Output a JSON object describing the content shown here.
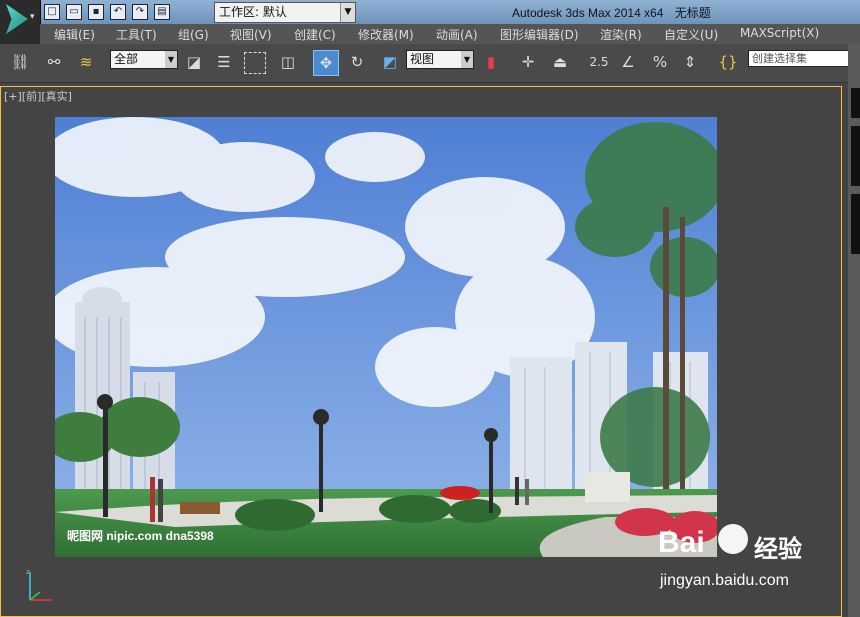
{
  "window": {
    "app_title": "Autodesk 3ds Max  2014 x64",
    "doc_title": "无标题"
  },
  "workspace": {
    "label": "工作区: 默认"
  },
  "menu": [
    "编辑(E)",
    "工具(T)",
    "组(G)",
    "视图(V)",
    "创建(C)",
    "修改器(M)",
    "动画(A)",
    "图形编辑器(D)",
    "渲染(R)",
    "自定义(U)",
    "MAXScript(X)"
  ],
  "toolbar": {
    "selection_filter": "全部",
    "ref_coord": "视图",
    "snap_label": "2.5",
    "named_selection_placeholder": "创建选择集"
  },
  "viewport": {
    "label": "[+][前][真实]"
  },
  "picture_caption": "昵图网 nipic.com  dna5398",
  "watermark": {
    "brand": "Bai",
    "brand_suffix": "经验",
    "url": "jingyan.baidu.com"
  },
  "icons": [
    "link-icon",
    "unlink-icon",
    "bind-spacewarp-icon",
    "select-object-icon",
    "select-by-name-icon",
    "rect-region-icon",
    "window-crossing-icon",
    "move-icon",
    "rotate-icon",
    "scale-icon",
    "pivot-icon",
    "manipulate-icon",
    "keyboard-shortcut-icon",
    "snap-toggle-icon",
    "angle-snap-icon",
    "percent-snap-icon",
    "spinner-snap-icon",
    "edit-named-sets-icon"
  ],
  "colors": {
    "viewport_border": "#ffbd3b",
    "active_button": "#4a8bd0",
    "sky": "#5c87d8"
  }
}
